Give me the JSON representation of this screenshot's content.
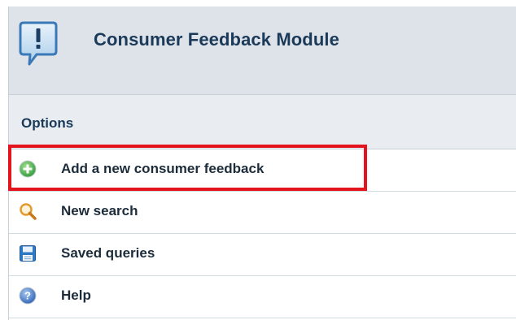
{
  "header": {
    "title": "Consumer Feedback Module",
    "icon": "feedback-speech-bubble-icon"
  },
  "options": {
    "label": "Options"
  },
  "menu": {
    "items": [
      {
        "label": "Add a new consumer feedback",
        "icon": "add-circle-icon",
        "highlighted": true
      },
      {
        "label": "New search",
        "icon": "search-icon",
        "highlighted": false
      },
      {
        "label": "Saved queries",
        "icon": "save-disk-icon",
        "highlighted": false
      },
      {
        "label": "Help",
        "icon": "help-icon",
        "highlighted": false
      }
    ]
  },
  "colors": {
    "header_bg": "#dde3e8",
    "title_text": "#1b3a5a",
    "highlight_border": "#e3141d",
    "add_icon_green": "#3fae49",
    "search_icon_orange": "#e59a2b",
    "save_icon_blue": "#2f78c4",
    "help_icon_blue": "#3b75c9"
  }
}
